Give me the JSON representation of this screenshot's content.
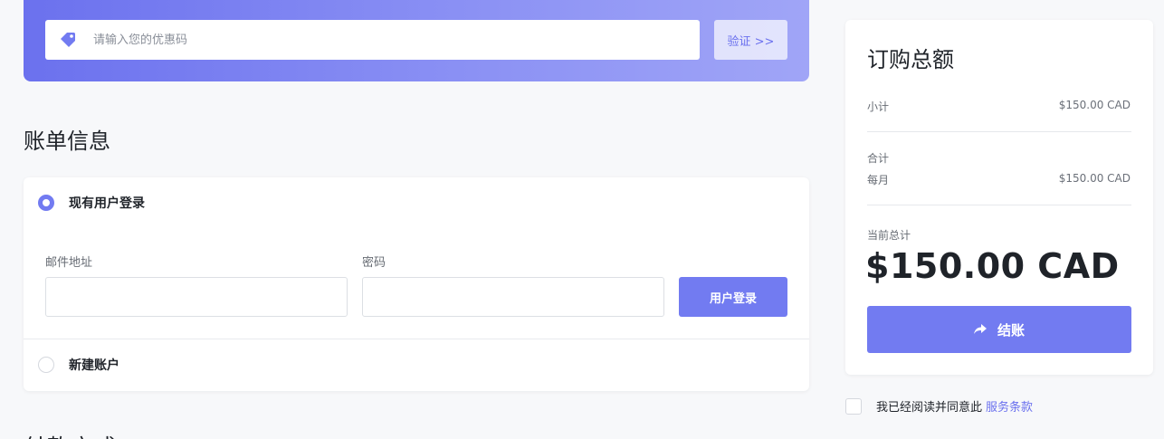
{
  "promo": {
    "placeholder": "请输入您的优惠码",
    "verify_label": "验证 >>",
    "icon": "tag-icon"
  },
  "billing": {
    "title": "账单信息",
    "existing_user_label": "现有用户登录",
    "email_label": "邮件地址",
    "password_label": "密码",
    "login_button": "用户登录",
    "new_account_label": "新建账户",
    "next_section_title_partial": "付款方式"
  },
  "summary": {
    "title": "订购总额",
    "subtotal_label": "小计",
    "subtotal_value": "$150.00 CAD",
    "total_label": "合计",
    "monthly_label": "每月",
    "monthly_value": "$150.00 CAD",
    "current_total_label": "当前总计",
    "current_total_value": "$150.00 CAD",
    "checkout_label": "结账",
    "checkout_icon": "share-arrow-icon"
  },
  "agreement": {
    "text": "我已经阅读并同意此",
    "link": "服务条款"
  },
  "colors": {
    "accent": "#727bf1",
    "gradient_start": "#6b71ee",
    "gradient_end": "#a0a5f7"
  }
}
